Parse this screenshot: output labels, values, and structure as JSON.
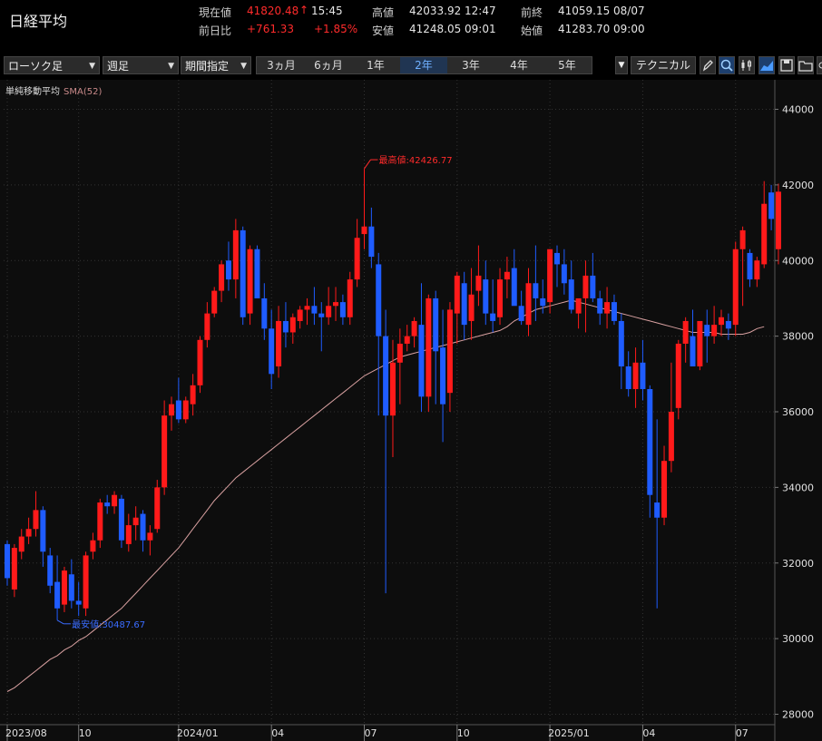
{
  "header": {
    "title": "日経平均",
    "rows": [
      {
        "label1": "現在値",
        "value1": "41820.48",
        "arrow": "↑",
        "extra1": "15:45",
        "label2": "高値",
        "value2": "42033.92",
        "extra2": "12:47",
        "label3": "前終",
        "value3": "41059.15",
        "extra3": "08/07"
      },
      {
        "label1": "前日比",
        "value1": "+761.33",
        "arrow": "",
        "extra1": "+1.85%",
        "label2": "安値",
        "value2": "41248.05",
        "extra2": "09:01",
        "label3": "始値",
        "value3": "41283.70",
        "extra3": "09:00"
      }
    ]
  },
  "toolbar": {
    "chart_type": "ローソク足",
    "interval": "週足",
    "range_mode": "期間指定",
    "periods": [
      "3ヵ月",
      "6ヵ月",
      "1年",
      "2年",
      "3年",
      "4年",
      "5年"
    ],
    "active_period": "2年",
    "technical": "テクニカル",
    "icons": [
      "pencil-icon",
      "zoom-icon",
      "candlestick-icon",
      "area-chart-icon",
      "save-icon",
      "folder-icon",
      "settings-icon"
    ]
  },
  "legend": {
    "label": "単純移動平均",
    "sma": "SMA(52)"
  },
  "colors": {
    "up": "#ff1a1a",
    "down": "#1f5cff",
    "sma": "#d8a0a0",
    "grid": "#333333",
    "bg": "#0d0d0d"
  },
  "chart_data": {
    "type": "candlestick",
    "interval": "weekly",
    "ylim": [
      28000,
      44000
    ],
    "yticks": [
      28000,
      30000,
      32000,
      34000,
      36000,
      38000,
      40000,
      42000,
      44000
    ],
    "xticks": [
      {
        "label": "2023/08",
        "index": 0
      },
      {
        "label": "10",
        "index": 10
      },
      {
        "label": "2024/01",
        "index": 24
      },
      {
        "label": "04",
        "index": 37
      },
      {
        "label": "07",
        "index": 50
      },
      {
        "label": "10",
        "index": 63
      },
      {
        "label": "2025/01",
        "index": 76
      },
      {
        "label": "04",
        "index": 89
      },
      {
        "label": "07",
        "index": 102
      }
    ],
    "ohlc": [
      [
        32500,
        32600,
        31400,
        31600
      ],
      [
        31300,
        32500,
        31100,
        32400
      ],
      [
        32300,
        32900,
        32100,
        32700
      ],
      [
        32700,
        33200,
        32500,
        32900
      ],
      [
        32900,
        33900,
        32700,
        33400
      ],
      [
        33400,
        33500,
        31900,
        32300
      ],
      [
        32200,
        32400,
        31200,
        31400
      ],
      [
        31500,
        32200,
        30487.67,
        30800
      ],
      [
        30900,
        31900,
        30700,
        31800
      ],
      [
        31700,
        32100,
        30800,
        31000
      ],
      [
        31000,
        31500,
        30600,
        30900
      ],
      [
        30800,
        32300,
        30600,
        32200
      ],
      [
        32300,
        32800,
        32100,
        32600
      ],
      [
        32600,
        33700,
        32400,
        33600
      ],
      [
        33600,
        33800,
        33300,
        33500
      ],
      [
        33500,
        33900,
        33300,
        33800
      ],
      [
        33700,
        33800,
        32400,
        32600
      ],
      [
        32500,
        33300,
        32300,
        33000
      ],
      [
        33000,
        33500,
        32600,
        33200
      ],
      [
        33300,
        33400,
        32300,
        32600
      ],
      [
        32600,
        33000,
        32200,
        32800
      ],
      [
        32900,
        34200,
        32800,
        34000
      ],
      [
        34000,
        36300,
        33800,
        35900
      ],
      [
        35900,
        36400,
        35500,
        36200
      ],
      [
        36300,
        36900,
        35700,
        35800
      ],
      [
        35800,
        36400,
        35700,
        36300
      ],
      [
        36200,
        37000,
        35900,
        36700
      ],
      [
        36700,
        38000,
        36500,
        37900
      ],
      [
        37900,
        38900,
        37700,
        38600
      ],
      [
        38600,
        39300,
        38500,
        39200
      ],
      [
        39200,
        40000,
        38900,
        39900
      ],
      [
        40000,
        40500,
        39200,
        39500
      ],
      [
        39500,
        41100,
        39000,
        40800
      ],
      [
        40800,
        40900,
        38300,
        38500
      ],
      [
        38600,
        40400,
        38300,
        40300
      ],
      [
        40300,
        40400,
        39100,
        39000
      ],
      [
        39000,
        39400,
        37900,
        38200
      ],
      [
        38200,
        38700,
        36600,
        37000
      ],
      [
        37200,
        38800,
        36900,
        38400
      ],
      [
        38400,
        38900,
        37700,
        38100
      ],
      [
        38100,
        38600,
        37800,
        38500
      ],
      [
        38400,
        38800,
        38200,
        38700
      ],
      [
        38700,
        39000,
        38300,
        38800
      ],
      [
        38800,
        39300,
        38300,
        38600
      ],
      [
        38600,
        38900,
        37600,
        38500
      ],
      [
        38500,
        39300,
        38300,
        38800
      ],
      [
        38800,
        39300,
        38400,
        38900
      ],
      [
        38900,
        39100,
        38300,
        38500
      ],
      [
        38500,
        39700,
        38300,
        39500
      ],
      [
        39500,
        41100,
        39300,
        40600
      ],
      [
        40700,
        42426.77,
        40300,
        40900
      ],
      [
        40900,
        41400,
        39800,
        40100
      ],
      [
        39900,
        40200,
        35900,
        38000
      ],
      [
        38000,
        38700,
        31200,
        35900
      ],
      [
        35900,
        37900,
        34800,
        37300
      ],
      [
        37300,
        38200,
        36200,
        37800
      ],
      [
        37800,
        38300,
        37600,
        38000
      ],
      [
        38000,
        38500,
        37700,
        38400
      ],
      [
        38300,
        39400,
        36000,
        36400
      ],
      [
        36400,
        39100,
        36000,
        39000
      ],
      [
        39000,
        39200,
        36200,
        37600
      ],
      [
        37700,
        38700,
        35200,
        36200
      ],
      [
        36500,
        38900,
        36000,
        38700
      ],
      [
        38600,
        39700,
        37800,
        39600
      ],
      [
        39400,
        39700,
        37900,
        38300
      ],
      [
        38400,
        39800,
        37900,
        39100
      ],
      [
        39200,
        40400,
        38800,
        39600
      ],
      [
        39500,
        40000,
        38300,
        38600
      ],
      [
        38600,
        39500,
        38100,
        38400
      ],
      [
        38500,
        39800,
        38300,
        39500
      ],
      [
        39500,
        40100,
        39000,
        39700
      ],
      [
        39800,
        40300,
        39200,
        38800
      ],
      [
        38800,
        39200,
        38300,
        38400
      ],
      [
        38300,
        39800,
        38000,
        39400
      ],
      [
        39400,
        40400,
        38400,
        39000
      ],
      [
        39000,
        39500,
        38600,
        38800
      ],
      [
        38900,
        40300,
        38600,
        40300
      ],
      [
        40200,
        40400,
        39300,
        39900
      ],
      [
        39900,
        40300,
        39100,
        39400
      ],
      [
        39500,
        40000,
        38600,
        38700
      ],
      [
        38600,
        38900,
        38200,
        39000
      ],
      [
        39000,
        40000,
        38100,
        39600
      ],
      [
        39600,
        40200,
        38900,
        39000
      ],
      [
        39000,
        39200,
        38300,
        38600
      ],
      [
        38600,
        39300,
        38200,
        38900
      ],
      [
        38900,
        39100,
        38300,
        38400
      ],
      [
        38400,
        38600,
        36600,
        37200
      ],
      [
        37200,
        37600,
        36400,
        36600
      ],
      [
        36600,
        37700,
        36100,
        37300
      ],
      [
        37300,
        37900,
        36300,
        36600
      ],
      [
        36600,
        36700,
        33200,
        33800
      ],
      [
        33600,
        35800,
        30800,
        33200
      ],
      [
        33200,
        35100,
        33000,
        34700
      ],
      [
        34700,
        37300,
        34400,
        36000
      ],
      [
        36100,
        37900,
        35800,
        37800
      ],
      [
        37800,
        38500,
        37300,
        38400
      ],
      [
        38000,
        38700,
        37500,
        37200
      ],
      [
        37200,
        38300,
        37100,
        38400
      ],
      [
        38300,
        38700,
        37300,
        38000
      ],
      [
        38000,
        38800,
        37800,
        38300
      ],
      [
        38300,
        38700,
        38000,
        38500
      ],
      [
        38400,
        38600,
        37900,
        38200
      ],
      [
        38300,
        40500,
        38000,
        40300
      ],
      [
        40300,
        40900,
        38800,
        40800
      ],
      [
        40200,
        40300,
        39300,
        39500
      ],
      [
        39500,
        40100,
        39300,
        40000
      ],
      [
        39900,
        42100,
        39800,
        41500
      ],
      [
        41800,
        42000,
        40800,
        41100
      ],
      [
        40300,
        42033.92,
        39900,
        41820.48
      ]
    ],
    "sma52": [
      28600,
      28700,
      28850,
      29000,
      29150,
      29300,
      29450,
      29550,
      29700,
      29800,
      29950,
      30050,
      30200,
      30350,
      30500,
      30650,
      30800,
      31000,
      31200,
      31400,
      31600,
      31800,
      32000,
      32200,
      32400,
      32650,
      32900,
      33150,
      33400,
      33650,
      33850,
      34050,
      34250,
      34400,
      34550,
      34700,
      34850,
      35000,
      35150,
      35300,
      35450,
      35600,
      35750,
      35900,
      36050,
      36200,
      36350,
      36500,
      36650,
      36800,
      36950,
      37050,
      37150,
      37250,
      37350,
      37450,
      37500,
      37550,
      37600,
      37650,
      37700,
      37750,
      37800,
      37850,
      37900,
      37950,
      38000,
      38050,
      38100,
      38150,
      38250,
      38400,
      38500,
      38600,
      38700,
      38750,
      38800,
      38850,
      38900,
      38950,
      38900,
      38850,
      38800,
      38750,
      38700,
      38650,
      38600,
      38550,
      38500,
      38450,
      38400,
      38350,
      38300,
      38250,
      38200,
      38150,
      38100,
      38100,
      38100,
      38100,
      38050,
      38050,
      38050,
      38050,
      38100,
      38200,
      38250
    ],
    "annotations": [
      {
        "text": "最高値:42426.77",
        "index": 50,
        "value": 42426.77,
        "color": "#ff2b2b"
      },
      {
        "text": "最安値:30487.67",
        "index": 7,
        "value": 30487.67,
        "color": "#3a6cff"
      }
    ]
  }
}
